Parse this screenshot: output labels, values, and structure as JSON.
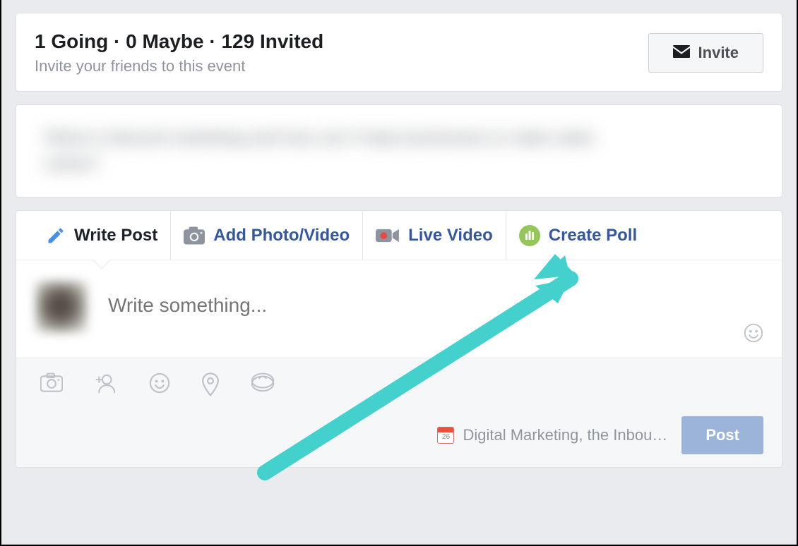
{
  "invite": {
    "title": "1 Going · 0 Maybe · 129 Invited",
    "subtitle": "Invite your friends to this event",
    "button": "Invite"
  },
  "composer": {
    "tabs": {
      "write": "Write Post",
      "photo": "Add Photo/Video",
      "live": "Live Video",
      "poll": "Create Poll"
    },
    "placeholder": "Write something...",
    "event_tag": "Digital Marketing, the Inbou…",
    "post_button": "Post"
  },
  "colors": {
    "fb_link": "#365899",
    "poll_icon": "#8bc34a",
    "arrow": "#44d1cd"
  }
}
